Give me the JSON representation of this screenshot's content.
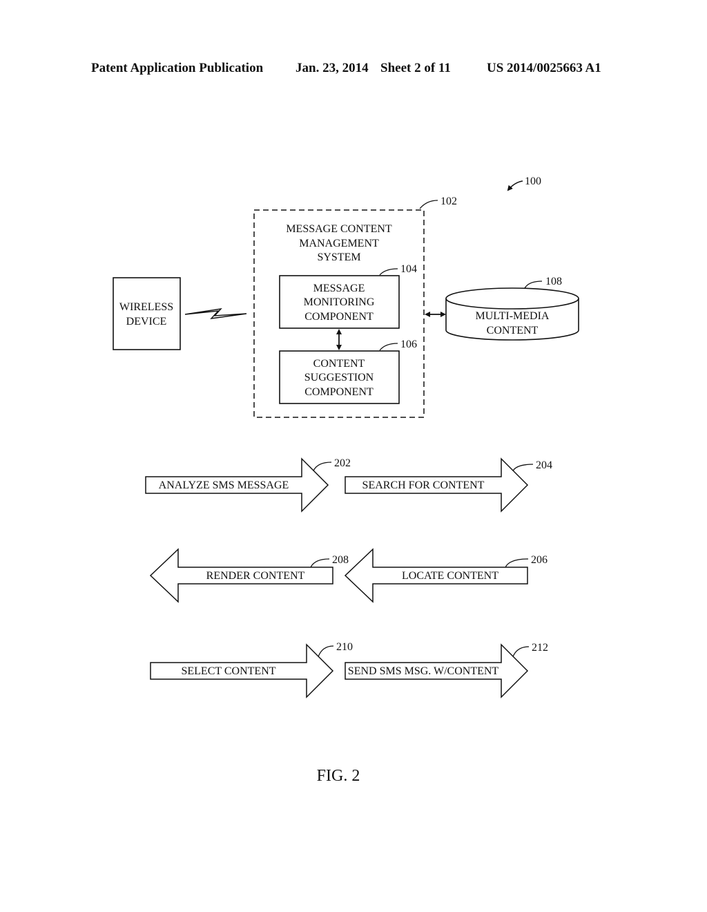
{
  "header": {
    "publication": "Patent Application Publication",
    "date": "Jan. 23, 2014",
    "sheet": "Sheet 2 of 11",
    "number": "US 2014/0025663 A1"
  },
  "diagram": {
    "system_ref": "100",
    "mcms": {
      "ref": "102",
      "lines": [
        "MESSAGE CONTENT",
        "MANAGEMENT",
        "SYSTEM"
      ]
    },
    "monitoring": {
      "ref": "104",
      "lines": [
        "MESSAGE",
        "MONITORING",
        "COMPONENT"
      ]
    },
    "suggestion": {
      "ref": "106",
      "lines": [
        "CONTENT",
        "SUGGESTION",
        "COMPONENT"
      ]
    },
    "wireless": {
      "lines": [
        "WIRELESS",
        "DEVICE"
      ]
    },
    "multimedia": {
      "ref": "108",
      "lines": [
        "MULTI-MEDIA",
        "CONTENT"
      ]
    },
    "steps": [
      {
        "ref": "202",
        "label": "ANALYZE SMS MESSAGE",
        "direction": "right"
      },
      {
        "ref": "204",
        "label": "SEARCH FOR CONTENT",
        "direction": "right"
      },
      {
        "ref": "206",
        "label": "LOCATE CONTENT",
        "direction": "left"
      },
      {
        "ref": "208",
        "label": "RENDER CONTENT",
        "direction": "left"
      },
      {
        "ref": "210",
        "label": "SELECT CONTENT",
        "direction": "right"
      },
      {
        "ref": "212",
        "label": "SEND SMS MSG. W/CONTENT",
        "direction": "right"
      }
    ],
    "caption": "FIG. 2"
  }
}
